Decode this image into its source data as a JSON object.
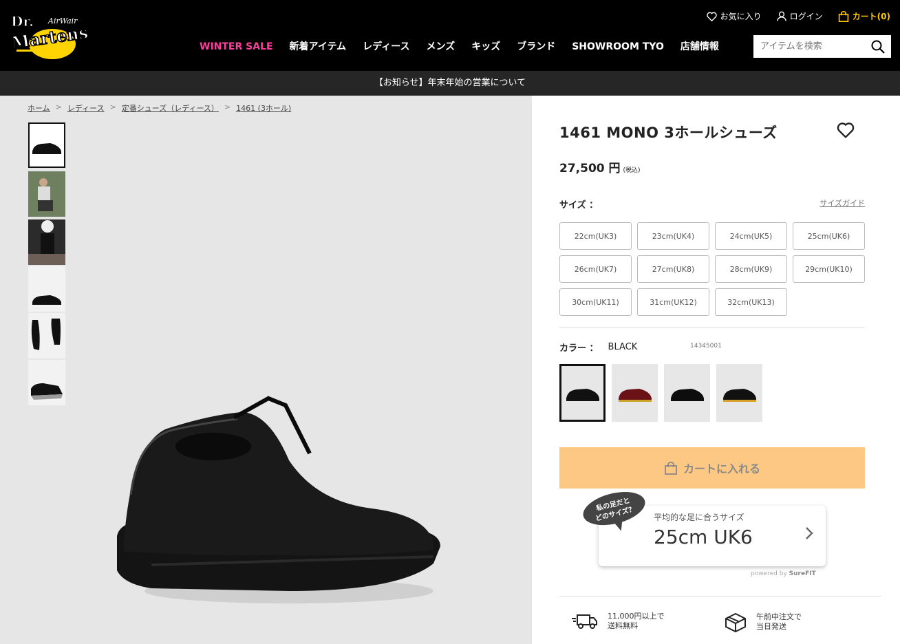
{
  "header": {
    "brand": "Dr. Martens AirWair",
    "logo_text_top": "Dr.",
    "logo_text_main": "Martens",
    "logo_text_air": "AirWair",
    "nav": [
      "WINTER SALE",
      "新着アイテム",
      "レディース",
      "メンズ",
      "キッズ",
      "ブランド",
      "SHOWROOM TYO",
      "店舗情報"
    ],
    "utility": {
      "favorites": "お気に入り",
      "login": "ログイン",
      "cart": "カート(0)"
    },
    "search_placeholder": "アイテムを検索",
    "icons": {
      "favorites": "heart-icon",
      "login": "user-icon",
      "cart": "bag-icon",
      "search": "search-icon"
    },
    "accent_sale": "#ff3fa0",
    "accent_cart": "#ffcc00"
  },
  "notice": "【お知らせ】年末年始の営業について",
  "breadcrumb": [
    "ホーム",
    "レディース",
    "定番シューズ（レディース）",
    "1461 (3ホール)"
  ],
  "product": {
    "title": "1461 MONO 3ホールシューズ",
    "price": "27,500 円",
    "tax_note": "(税込)",
    "size_label": "サイズ ：",
    "size_guide": "サイズガイド",
    "sizes": [
      "22cm(UK3)",
      "23cm(UK4)",
      "24cm(UK5)",
      "25cm(UK6)",
      "26cm(UK7)",
      "27cm(UK8)",
      "28cm(UK9)",
      "29cm(UK10)",
      "30cm(UK11)",
      "31cm(UK12)",
      "32cm(UK13)"
    ],
    "color_label": "カラー ：",
    "color_value": "BLACK",
    "sku": "14345001",
    "swatches": [
      "black-mono",
      "cherry-red",
      "black-smooth",
      "black-yellow-stitch"
    ],
    "cart_button": "カートに入れる",
    "cart_button_color": "#fdc883"
  },
  "surefit": {
    "bubble_line1": "私の足だと",
    "bubble_line2": "どのサイズ？",
    "label": "平均的な足に合うサイズ",
    "value": "25cm UK6",
    "powered_prefix": "powered by",
    "powered_brand": "SureFIT"
  },
  "features": [
    {
      "icon": "truck-icon",
      "line1": "11,000円以上で",
      "line2": "送料無料"
    },
    {
      "icon": "box-icon",
      "line1": "午前中注文で",
      "line2": "当日発送"
    }
  ]
}
